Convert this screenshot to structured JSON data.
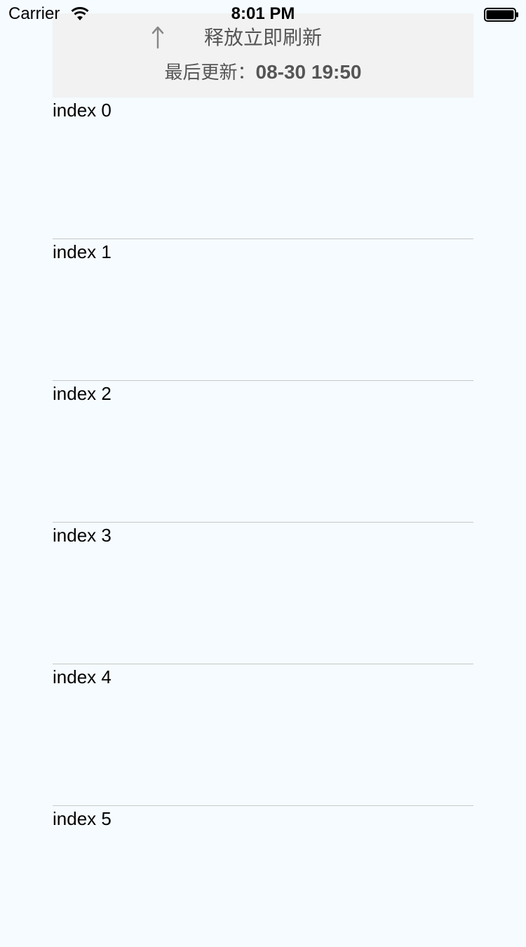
{
  "status_bar": {
    "carrier": "Carrier",
    "time": "8:01 PM"
  },
  "refresh_header": {
    "state_text": "释放立即刷新",
    "updated_prefix": "最后更新：",
    "updated_time": "08-30 19:50",
    "arrow_icon": "arrow-up-icon"
  },
  "list": {
    "rows": [
      {
        "label": "index 0"
      },
      {
        "label": "index 1"
      },
      {
        "label": "index 2"
      },
      {
        "label": "index 3"
      },
      {
        "label": "index 4"
      },
      {
        "label": "index 5"
      }
    ]
  },
  "colors": {
    "background": "#f5fbff",
    "header_background": "#f2f2f2",
    "separator": "#c8c8c8",
    "header_text": "#555555"
  }
}
